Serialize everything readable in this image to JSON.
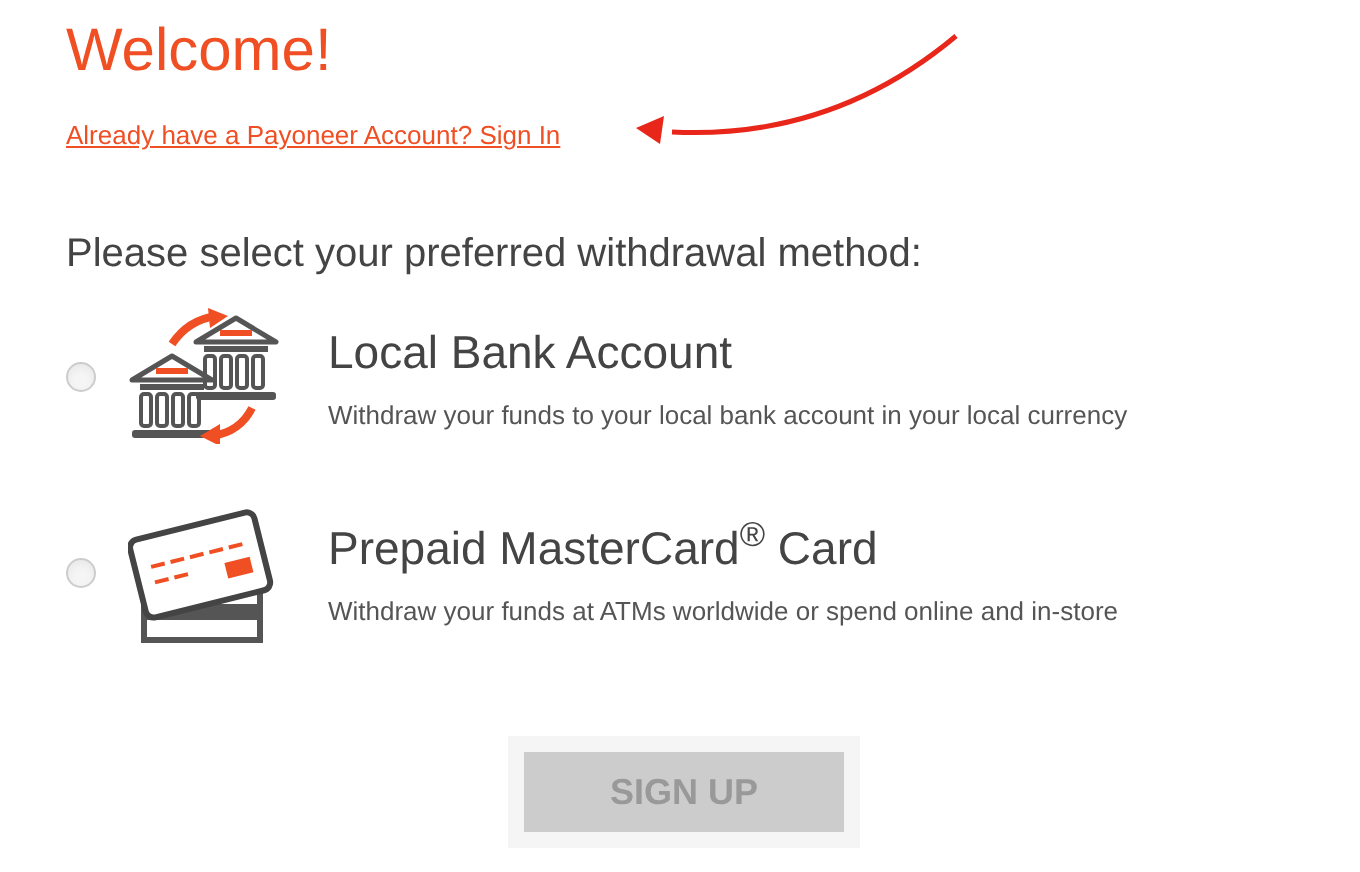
{
  "title": "Welcome!",
  "sign_in_link": "Already have a Payoneer Account? Sign In",
  "prompt": "Please select your preferred withdrawal method:",
  "options": [
    {
      "kind": "bank",
      "title": "Local Bank Account",
      "description": "Withdraw your funds to your local bank account in your local currency",
      "selected": false
    },
    {
      "kind": "card",
      "title": "Prepaid MasterCard$^{®}$ Card",
      "description": "Withdraw your funds at ATMs worldwide or spend online and in-store",
      "selected": false
    }
  ],
  "submit": {
    "label": "SIGN UP",
    "disabled": true
  }
}
